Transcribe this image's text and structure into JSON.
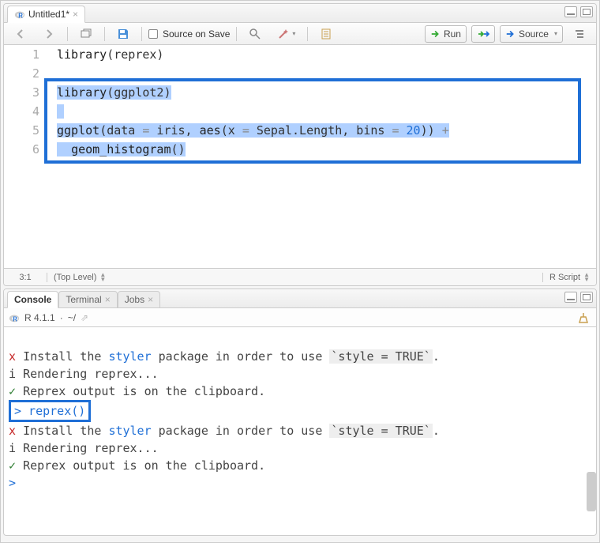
{
  "source": {
    "tab_title": "Untitled1*",
    "source_on_save_label": "Source on Save",
    "run_label": "Run",
    "source_button_label": "Source",
    "lines": [
      "library(reprex)",
      "",
      "library(ggplot2)",
      "",
      "ggplot(data = iris, aes(x = Sepal.Length, bins = 20)) +",
      "  geom_histogram()"
    ],
    "line_numbers": [
      "1",
      "2",
      "3",
      "4",
      "5",
      "6"
    ],
    "cursor_pos": "3:1",
    "scope": "(Top Level)",
    "lang": "R Script"
  },
  "console": {
    "tabs": [
      "Console",
      "Terminal",
      "Jobs"
    ],
    "r_version": "R 4.1.1",
    "cwd": "~/",
    "lines": [
      {
        "type": "x",
        "text": "Install the ",
        "link": "styler",
        "text2": " package in order to use ",
        "code": "`style = TRUE`",
        "text3": "."
      },
      {
        "type": "i",
        "text": "Rendering reprex..."
      },
      {
        "type": "ok",
        "text": "Reprex output is on the clipboard."
      },
      {
        "type": "prompt_boxed",
        "text": "reprex()"
      },
      {
        "type": "x",
        "text": "Install the ",
        "link": "styler",
        "text2": " package in order to use ",
        "code": "`style = TRUE`",
        "text3": "."
      },
      {
        "type": "i",
        "text": "Rendering reprex..."
      },
      {
        "type": "ok",
        "text": "Reprex output is on the clipboard."
      },
      {
        "type": "prompt",
        "text": ""
      }
    ]
  }
}
